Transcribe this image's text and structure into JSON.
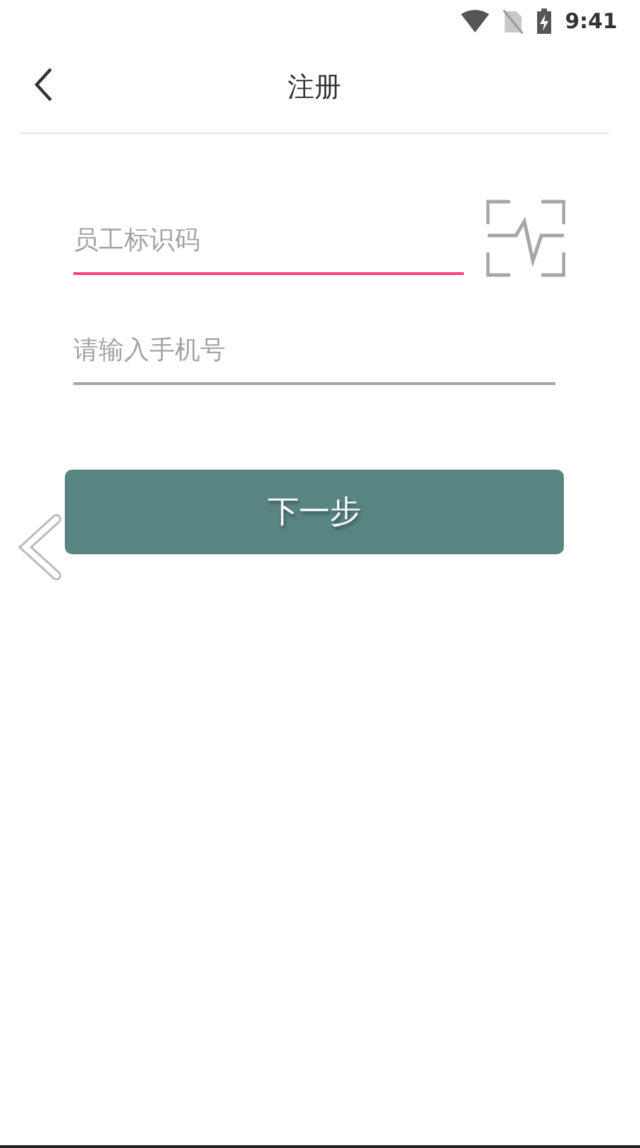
{
  "status_bar": {
    "time": "9:41"
  },
  "header": {
    "title": "注册"
  },
  "fields": [
    {
      "placeholder": "员工标识码",
      "focused": true,
      "kind": "scan"
    },
    {
      "placeholder": "请输入手机号",
      "focused": false,
      "kind": "plain"
    }
  ],
  "next_button": {
    "label": "下一步"
  }
}
